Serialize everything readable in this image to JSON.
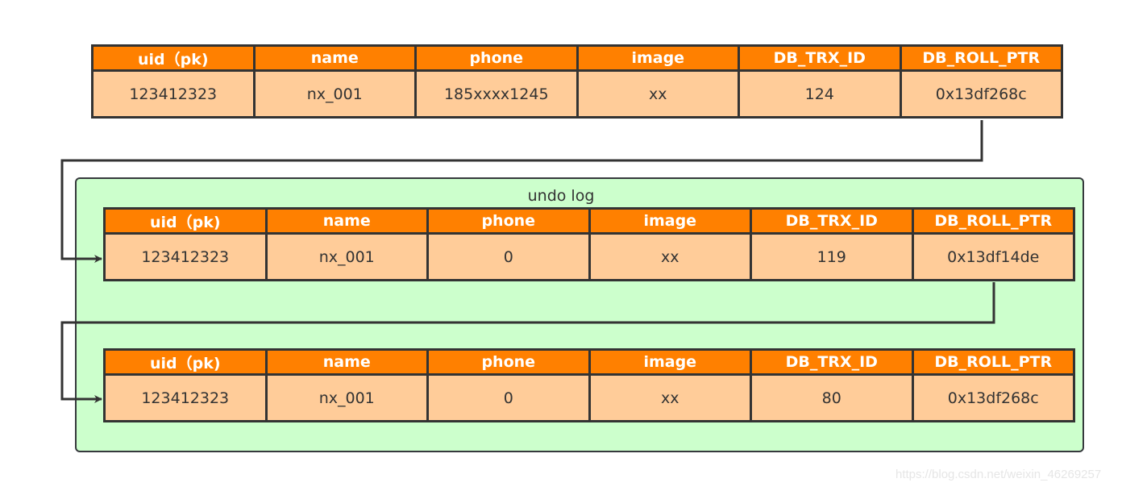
{
  "columns": [
    "uid（pk)",
    "name",
    "phone",
    "image",
    "DB_TRX_ID",
    "DB_ROLL_PTR"
  ],
  "current_record": [
    "123412323",
    "nx_001",
    "185xxxx1245",
    "xx",
    "124",
    "0x13df268c"
  ],
  "undo_log": {
    "label": "undo log",
    "records": [
      [
        "123412323",
        "nx_001",
        "0",
        "xx",
        "119",
        "0x13df14de"
      ],
      [
        "123412323",
        "nx_001",
        "0",
        "xx",
        "80",
        "0x13df268c"
      ]
    ]
  },
  "colors": {
    "header": "#ff8000",
    "cell": "#ffcc99",
    "undo_box": "#ccffcc",
    "border": "#333333"
  },
  "watermark": "https://blog.csdn.net/weixin_46269257"
}
